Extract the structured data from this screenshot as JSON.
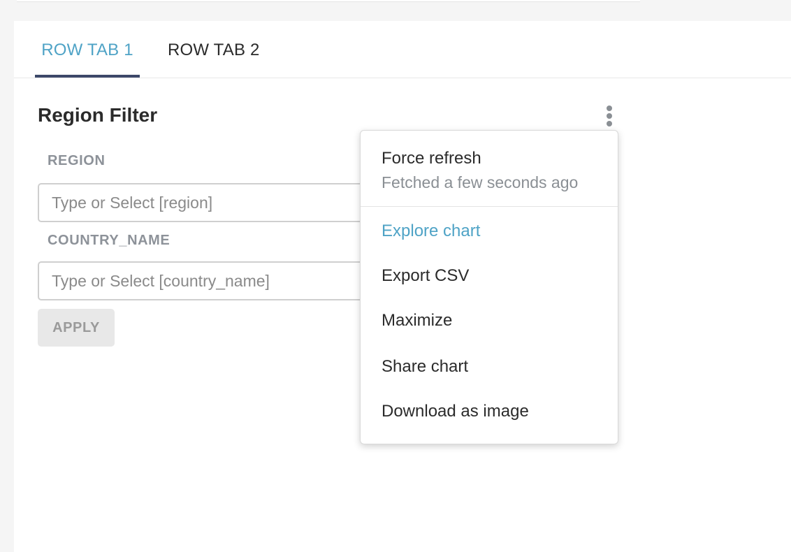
{
  "tabs": [
    {
      "label": "ROW TAB 1",
      "active": true
    },
    {
      "label": "ROW TAB 2",
      "active": false
    }
  ],
  "chart": {
    "title": "Region Filter"
  },
  "filters": [
    {
      "label": "REGION",
      "placeholder": "Type or Select [region]",
      "value": ""
    },
    {
      "label": "COUNTRY_NAME",
      "placeholder": "Type or Select [country_name]",
      "value": ""
    }
  ],
  "apply": {
    "label": "APPLY"
  },
  "menu": {
    "force_refresh": "Force refresh",
    "fetched_status": "Fetched a few seconds ago",
    "explore_chart": "Explore chart",
    "export_csv": "Export CSV",
    "maximize": "Maximize",
    "share_chart": "Share chart",
    "download_image": "Download as image"
  },
  "colors": {
    "accent": "#4fa3c6",
    "tab_underline": "#3c4869",
    "muted_text": "#8a8f94",
    "apply_bg": "#e8e8e8"
  },
  "icons": {
    "more": "vertical-ellipsis-icon"
  }
}
